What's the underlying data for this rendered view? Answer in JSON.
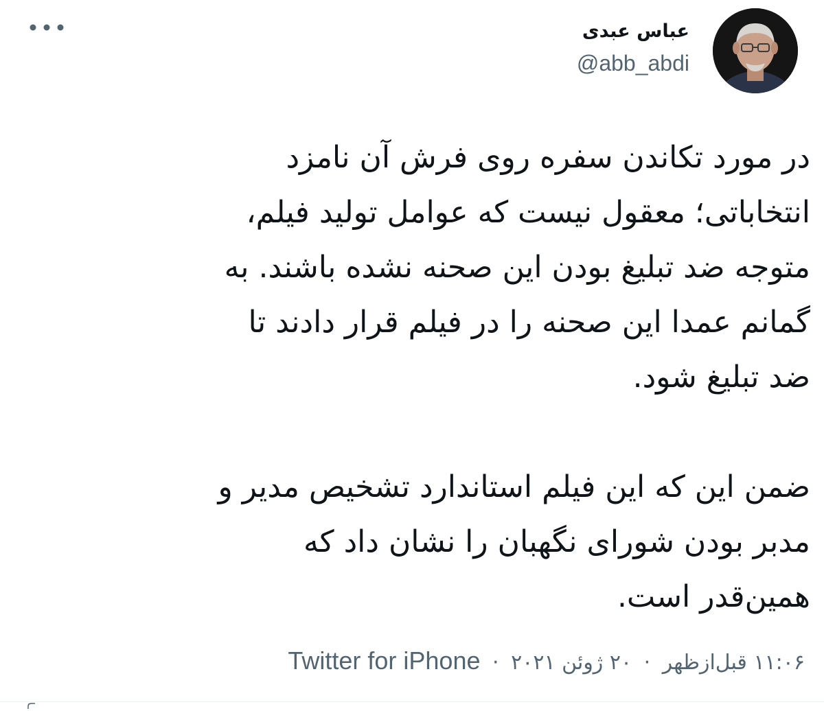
{
  "author": {
    "display_name": "عباس عبدی",
    "handle": "@abb_abdi"
  },
  "header": {
    "more_icon": "more-dots-icon"
  },
  "tweet": {
    "paragraph1": [
      "در مورد تکاندن سفره روی فرش آن نامزد",
      "انتخاباتی؛ معقول نیست که عوامل تولید فیلم،",
      "متوجه ضد تبلیغ بودن این صحنه نشده باشند. به",
      "گمانم عمدا این صحنه را در فیلم قرار دادند تا",
      "ضد تبلیغ شود."
    ],
    "paragraph2": [
      "ضمن این که این فیلم استاندارد تشخیص مدیر و",
      "مدبر بودن شورای نگهبان را نشان داد که",
      "همین‌قدر است."
    ]
  },
  "meta": {
    "time": "۱۱:۰۶ قبل‌ازظهر",
    "date": "۲۰ ژوئن ۲۰۲۱",
    "separator": "·",
    "source": "Twitter for iPhone"
  },
  "colors": {
    "text": "#0f1419",
    "secondary": "#536471"
  }
}
